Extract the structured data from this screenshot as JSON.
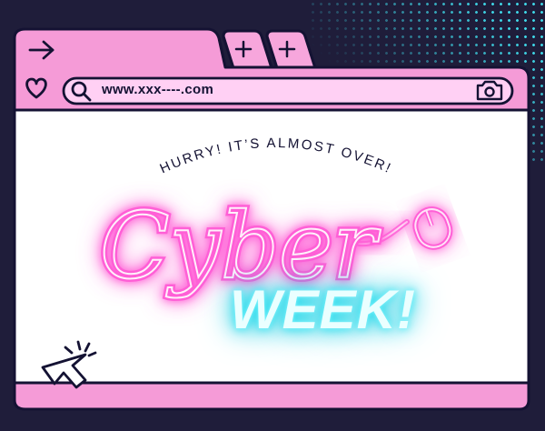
{
  "browser": {
    "url": "www.xxx----.com",
    "tabs": [
      {
        "icon": "plus-icon"
      },
      {
        "icon": "plus-icon"
      }
    ],
    "nav_icon": "arrow-right-icon",
    "favorite_icon": "heart-icon",
    "search_icon": "search-icon",
    "camera_icon": "camera-icon"
  },
  "banner": {
    "tagline": "HURRY! IT’S ALMOST OVER!",
    "script_word": "Cyber",
    "headline": "WEEK!"
  },
  "colors": {
    "background": "#1f1d3a",
    "pink": "#f59bd7",
    "light_pink": "#ffd0f4",
    "neon_pink": "#ff5fd6",
    "neon_cyan": "#22e0f0",
    "outline": "#141233"
  }
}
